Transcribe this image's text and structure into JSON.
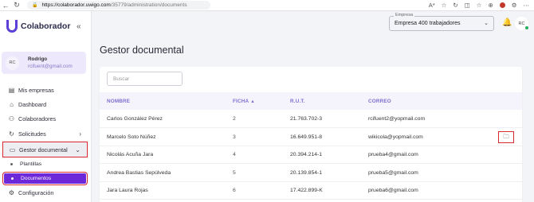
{
  "browser": {
    "url_host": "https://colaborador.uwigo.com",
    "url_path": "/35779/administration/documents",
    "back": "←",
    "reload": "↻",
    "lock": "🔒",
    "right_icons": [
      "A*",
      "☆",
      "↻",
      "◫",
      "☆",
      "⊕",
      "⚙",
      "⋯"
    ]
  },
  "sidebar": {
    "logo_text": "Colaborador",
    "collapse_icon": "«",
    "user": {
      "initials": "RC",
      "name": "Rodrigo",
      "email": "rcifuent@gmail.com"
    },
    "menu": {
      "mis_empresas": {
        "label": "Mis empresas",
        "icon": "building-icon",
        "glyph": "▤"
      },
      "dashboard": {
        "label": "Dashboard",
        "icon": "home-icon",
        "glyph": "⌂"
      },
      "colaboradores": {
        "label": "Colaboradores",
        "icon": "people-icon",
        "glyph": "⚇"
      },
      "solicitudes": {
        "label": "Solicitudes",
        "icon": "refresh-icon",
        "glyph": "↻",
        "chevron": "›"
      },
      "gestor_documental": {
        "label": "Gestor documental",
        "icon": "folder-icon",
        "glyph": "▭",
        "chevron": "⌄"
      },
      "plantillas": {
        "label": "Plantillas"
      },
      "documentos": {
        "label": "Documentos"
      },
      "configuracion": {
        "label": "Configuración",
        "icon": "gear-icon",
        "glyph": "⚙"
      }
    }
  },
  "header": {
    "company_label": "Empresa",
    "company_value": "Empresa 400 trabajadores",
    "company_chevron": "⌄",
    "bell": "🔔",
    "avatar_initials": "RC"
  },
  "page": {
    "title": "Gestor documental",
    "search_placeholder": "Buscar"
  },
  "table": {
    "columns": {
      "nombre": "NOMBRE",
      "ficha": "FICHA",
      "rut": "R.U.T.",
      "correo": "CORREO",
      "sort_indicator": "▲"
    },
    "rows": [
      {
        "nombre": "Carlos González Pérez",
        "ficha": "2",
        "rut": "21.763.702-3",
        "correo": "rcifuent2@yopmail.com",
        "action": false
      },
      {
        "nombre": "Marcelo Soto Núñez",
        "ficha": "3",
        "rut": "16.649.951-8",
        "correo": "wikicola@yopmail.com",
        "action": true,
        "action_glyph": "🗀"
      },
      {
        "nombre": "Nicolás Acuña Jara",
        "ficha": "4",
        "rut": "20.394.214-1",
        "correo": "prueba4@gmail.com",
        "action": false
      },
      {
        "nombre": "Andrea Bastias Sepúlveda",
        "ficha": "5",
        "rut": "20.139.854-1",
        "correo": "prueba5@gmail.com",
        "action": false
      },
      {
        "nombre": "Jara Laura Rojas",
        "ficha": "6",
        "rut": "17.422.899-K",
        "correo": "prueba6@gmail.com",
        "action": false
      }
    ]
  },
  "colors": {
    "accent": "#6d28d9",
    "highlight_border": "#d8292f",
    "table_header_text": "#7d6fcf"
  }
}
